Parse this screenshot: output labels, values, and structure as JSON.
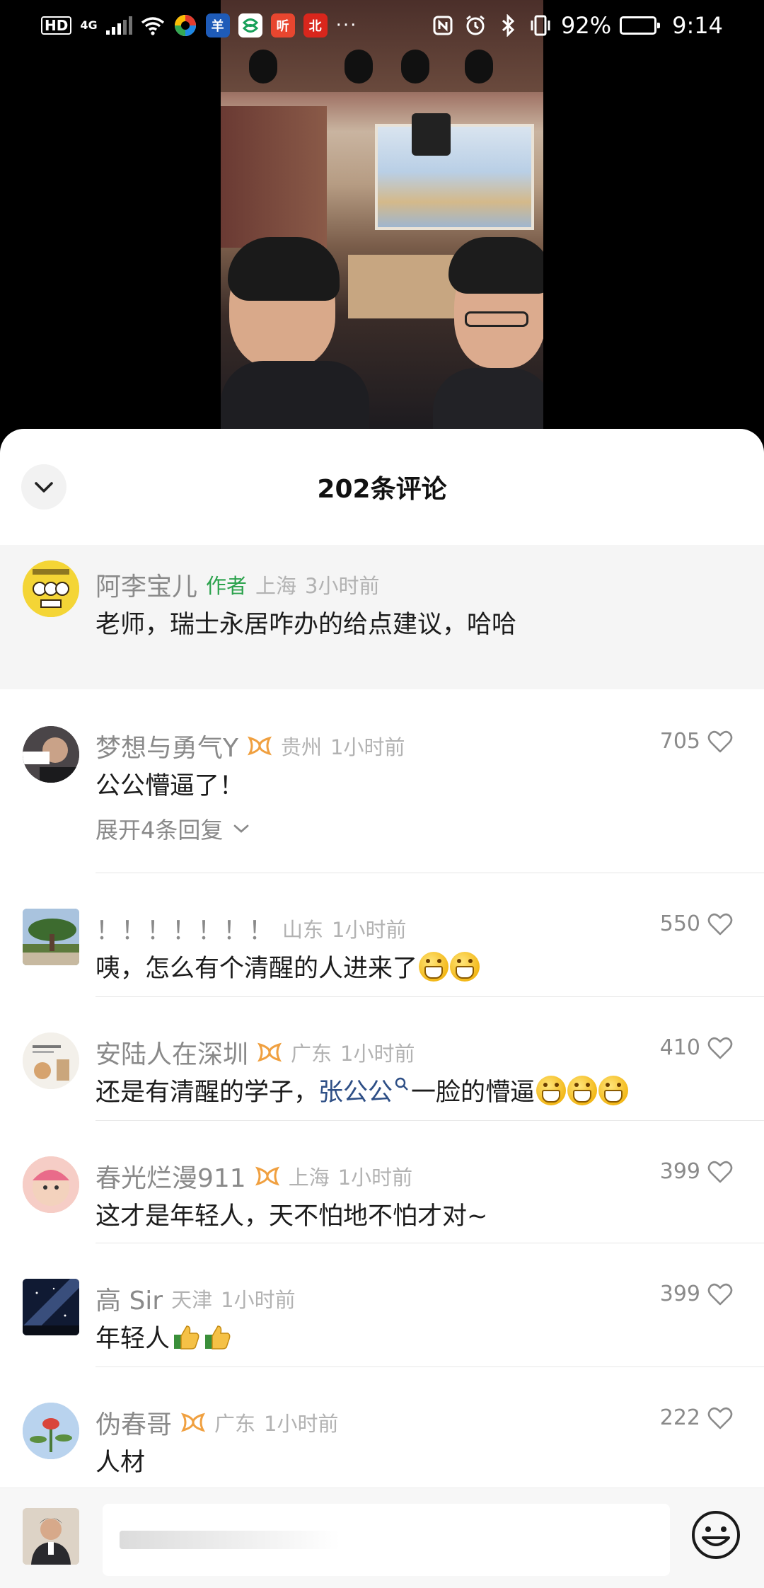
{
  "status_bar": {
    "hd": "HD",
    "network": "4G",
    "apps": [
      {
        "name": "baidu-app-icon",
        "color": "#e33b2d"
      },
      {
        "name": "news-app-icon",
        "text": "羊",
        "color": "#1e5bb8"
      },
      {
        "name": "china-mobile-app-icon",
        "color": "#ffffff"
      },
      {
        "name": "ting-app-icon",
        "text": "听",
        "color": "#e8462f"
      },
      {
        "name": "bj-app-icon",
        "text": "北",
        "color": "#d9261c"
      }
    ],
    "more": "···",
    "battery_percent": "92%",
    "battery_level": 0.92,
    "time": "9:14"
  },
  "header": {
    "title": "202条评论",
    "collapse_icon": "chevron-down-icon"
  },
  "pinned": {
    "name": "阿李宝儿",
    "author_tag": "作者",
    "location": "上海",
    "time": "3小时前",
    "text": "老师，瑞士永居咋办的给点建议，哈哈"
  },
  "comments": [
    {
      "name": "梦想与勇气Y",
      "badge": true,
      "location": "贵州",
      "time": "1小时前",
      "likes": "705",
      "text": "公公懵逼了！",
      "expand": "展开4条回复"
    },
    {
      "name": "！！！！！！！",
      "badge": false,
      "location": "山东",
      "time": "1小时前",
      "likes": "550",
      "text": "咦，怎么有个清醒的人进来了"
    },
    {
      "name": "安陆人在深圳",
      "badge": true,
      "location": "广东",
      "time": "1小时前",
      "likes": "410",
      "text_before": "还是有清醒的学子，",
      "mention": "张公公",
      "text_after": "一脸的懵逼"
    },
    {
      "name": "春光烂漫911",
      "badge": true,
      "location": "上海",
      "time": "1小时前",
      "likes": "399",
      "text": "这才是年轻人，天不怕地不怕才对~"
    },
    {
      "name": "高 Sir",
      "badge": false,
      "location": "天津",
      "time": "1小时前",
      "likes": "399",
      "text": "年轻人"
    },
    {
      "name": "伪春哥",
      "badge": true,
      "location": "广东",
      "time": "1小时前",
      "likes": "222",
      "text": "人材"
    }
  ],
  "colors": {
    "author_green": "#2ba24c",
    "mention_blue": "#2e4f86",
    "badge_orange": "#f0a040"
  }
}
